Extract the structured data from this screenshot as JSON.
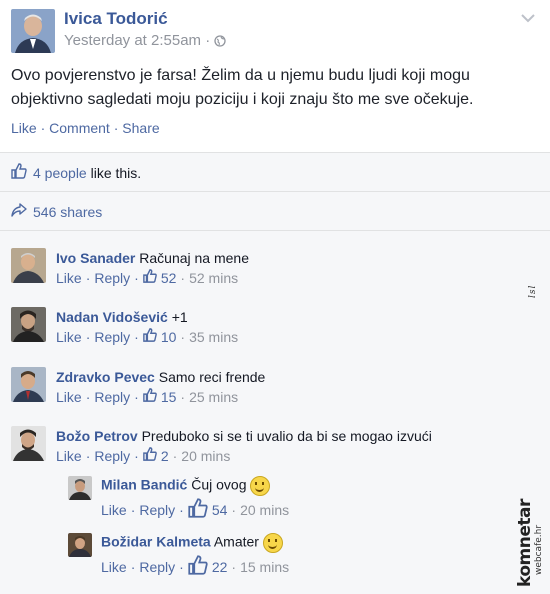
{
  "post": {
    "author": "Ivica Todorić",
    "time": "Yesterday at 2:55am",
    "time_sep": "·",
    "text": "Ovo povjerenstvo je farsa! Želim da u njemu budu ljudi koji mogu objektivno sagledati moju poziciju i koji znaju što me sve očekuje.",
    "actions": [
      "Like",
      "Comment",
      "Share"
    ],
    "action_sep": "·"
  },
  "likes": {
    "count_text": "4 people",
    "suffix": " like this."
  },
  "shares": {
    "text": "546 shares"
  },
  "comments": [
    {
      "name": "Ivo Sanader",
      "text": "Računaj na mene",
      "like": "Like",
      "reply": "Reply",
      "count": "52",
      "time": "52 mins"
    },
    {
      "name": "Nadan Vidošević",
      "text": "+1",
      "like": "Like",
      "reply": "Reply",
      "count": "10",
      "time": "35 mins"
    },
    {
      "name": "Zdravko Pevec",
      "text": "Samo reci frende",
      "like": "Like",
      "reply": "Reply",
      "count": "15",
      "time": "25 mins"
    },
    {
      "name": "Božo Petrov",
      "text": "Preduboko si se ti uvalio da bi se mogao izvući",
      "like": "Like",
      "reply": "Reply",
      "count": "2",
      "time": "20 mins"
    }
  ],
  "replies": [
    {
      "name": "Milan Bandić",
      "text": "Čuj ovog",
      "like": "Like",
      "reply": "Reply",
      "count": "54",
      "time": "20 mins"
    },
    {
      "name": "Božidar Kalmeta",
      "text": "Amater",
      "like": "Like",
      "reply": "Reply",
      "count": "22",
      "time": "15 mins"
    }
  ],
  "watermark": {
    "brand": "komnetar",
    "sub": "webcafe.hr",
    "side": "lsl"
  },
  "colors": {
    "link": "#4e69a2",
    "name": "#3b5998",
    "muted": "#90949c",
    "bg": "#f6f7f9"
  }
}
